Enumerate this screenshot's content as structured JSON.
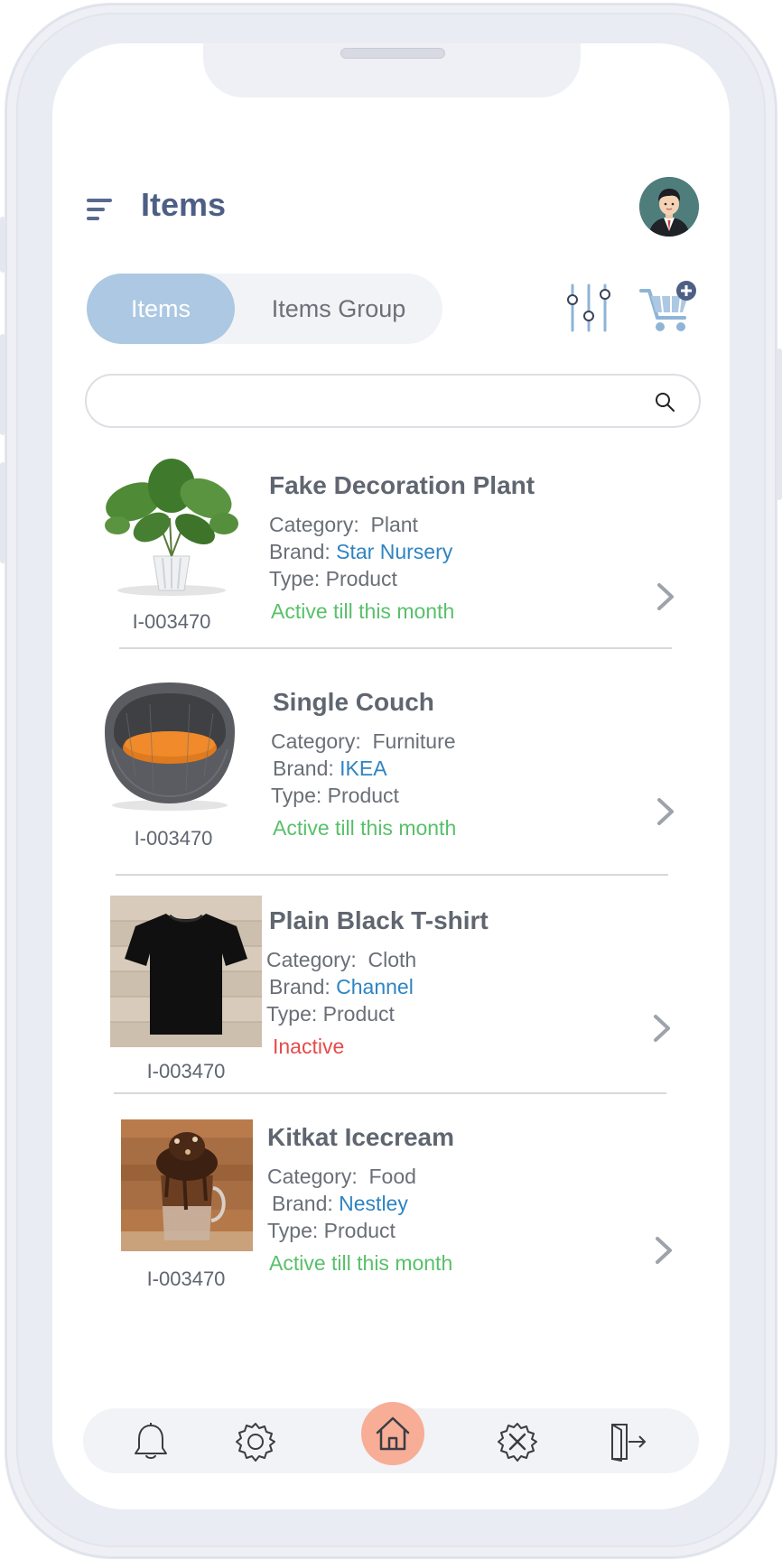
{
  "header": {
    "title": "Items"
  },
  "tabs": [
    {
      "label": "Items",
      "active": true
    },
    {
      "label": "Items Group",
      "active": false
    }
  ],
  "search": {
    "value": "",
    "placeholder": ""
  },
  "labels": {
    "category": "Category:",
    "brand": "Brand:",
    "type": "Type:"
  },
  "items": [
    {
      "name": "Fake Decoration Plant",
      "code": "I-003470",
      "category": "Plant",
      "brand": "Star Nursery",
      "type": "Product",
      "status": "Active till this month",
      "thumbnail": "potted-plant"
    },
    {
      "name": "Single Couch",
      "code": "I-003470",
      "category": "Furniture",
      "brand": "IKEA",
      "type": "Product",
      "status": "Active till this month",
      "thumbnail": "round-wicker-chair"
    },
    {
      "name": "Plain Black T-shirt",
      "code": "I-003470",
      "category": "Cloth",
      "brand": "Channel",
      "type": "Product",
      "status": "Inactive",
      "thumbnail": "black-tshirt"
    },
    {
      "name": "Kitkat Icecream",
      "code": "I-003470",
      "category": "Food",
      "brand": "Nestley",
      "type": "Product",
      "status": "Active till this month",
      "thumbnail": "chocolate-shake"
    }
  ],
  "bottom_nav": [
    "bell-icon",
    "settings-gear-icon",
    "home-icon",
    "tools-icon",
    "logout-icon"
  ],
  "colors": {
    "accent": "#acc8e2",
    "title": "#4e5f86",
    "brand": "#2f84c2",
    "active": "#58c06a",
    "inactive": "#e84a4a",
    "home": "#f7ad96"
  }
}
